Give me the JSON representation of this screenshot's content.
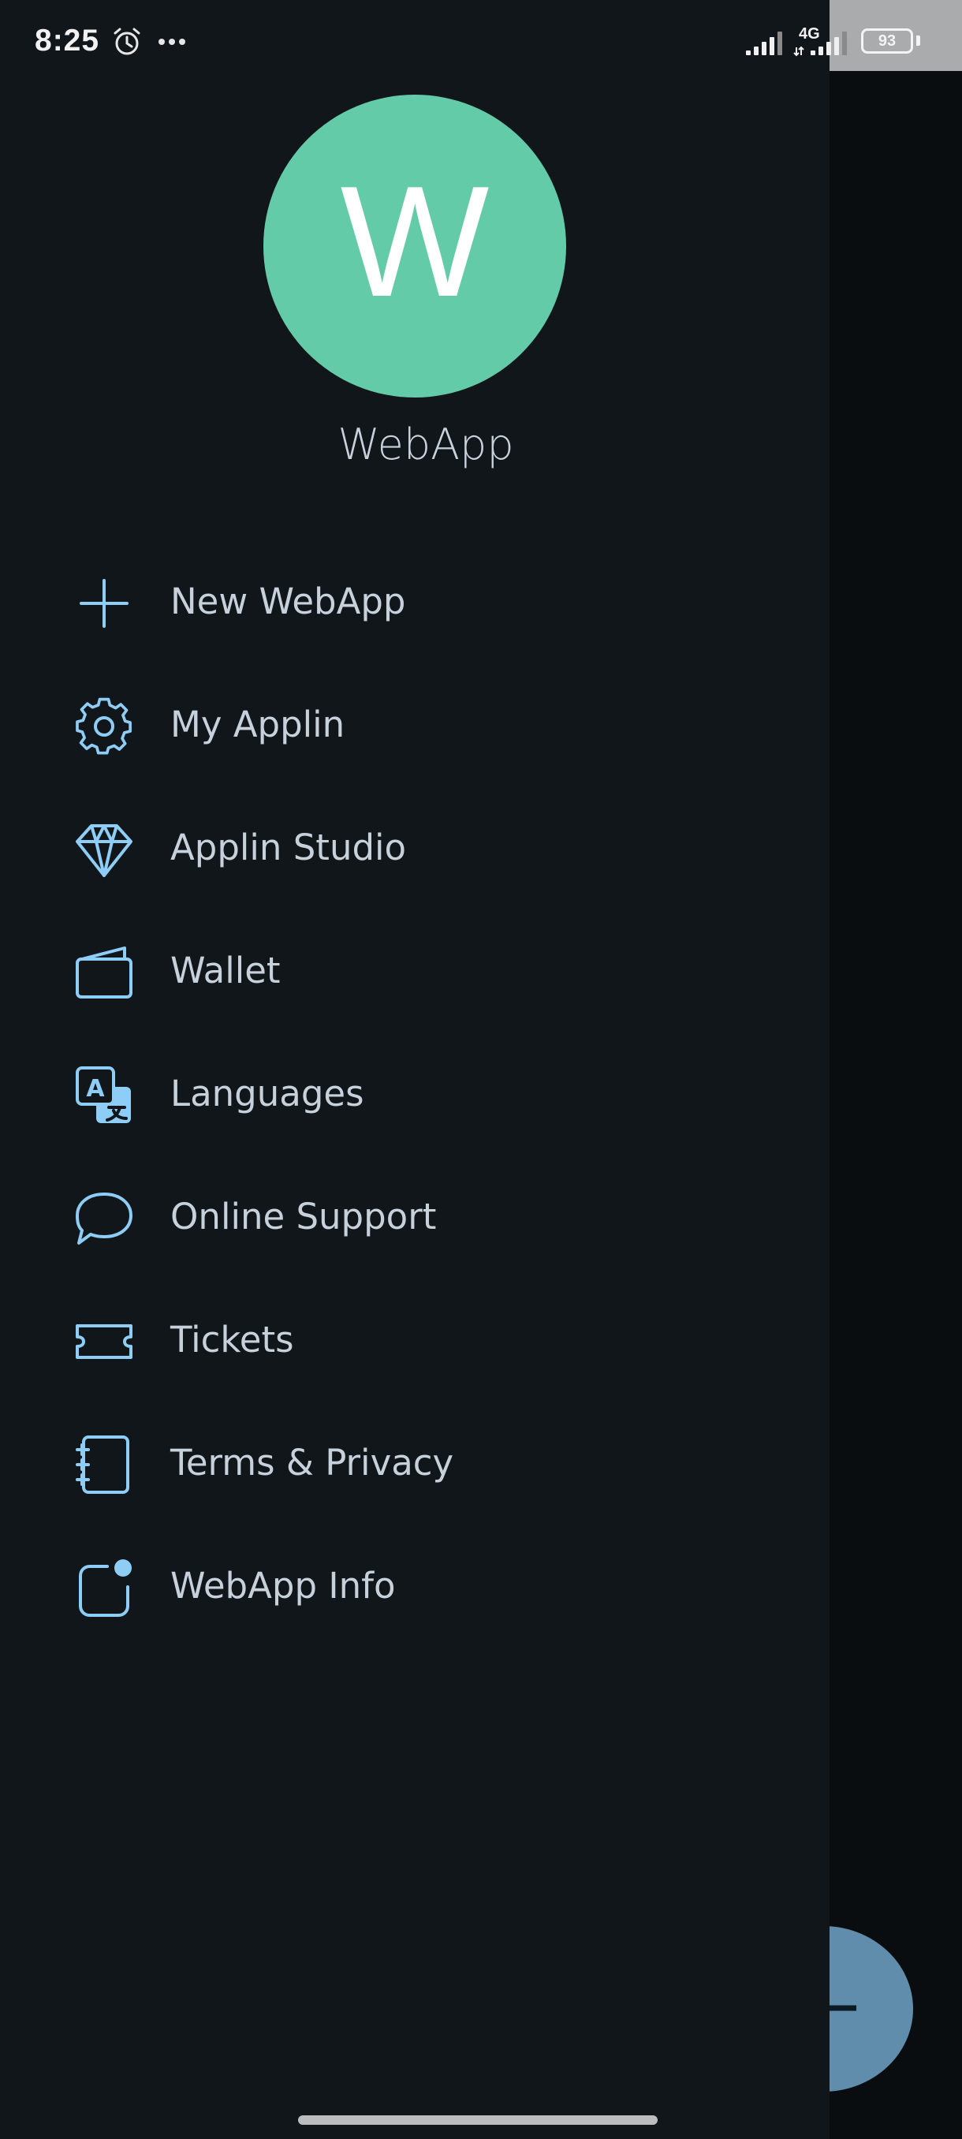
{
  "status_bar": {
    "time": "8:25",
    "network_type": "4G",
    "battery_level": "93"
  },
  "profile": {
    "avatar_letter": "W",
    "name": "WebApp",
    "avatar_color": "#64cba8"
  },
  "menu": {
    "items": [
      {
        "label": "New WebApp",
        "icon": "plus-icon"
      },
      {
        "label": "My Applin",
        "icon": "gear-icon"
      },
      {
        "label": "Applin Studio",
        "icon": "diamond-icon"
      },
      {
        "label": "Wallet",
        "icon": "wallet-icon"
      },
      {
        "label": "Languages",
        "icon": "translate-icon"
      },
      {
        "label": "Online Support",
        "icon": "chat-bubble-icon"
      },
      {
        "label": "Tickets",
        "icon": "ticket-icon"
      },
      {
        "label": "Terms & Privacy",
        "icon": "notebook-icon"
      },
      {
        "label": "WebApp Info",
        "icon": "app-info-icon"
      }
    ]
  },
  "colors": {
    "accent": "#8ecdf5",
    "drawer_background": "#11161a",
    "text": "#c7d1db",
    "fab": "#5f8dab"
  }
}
